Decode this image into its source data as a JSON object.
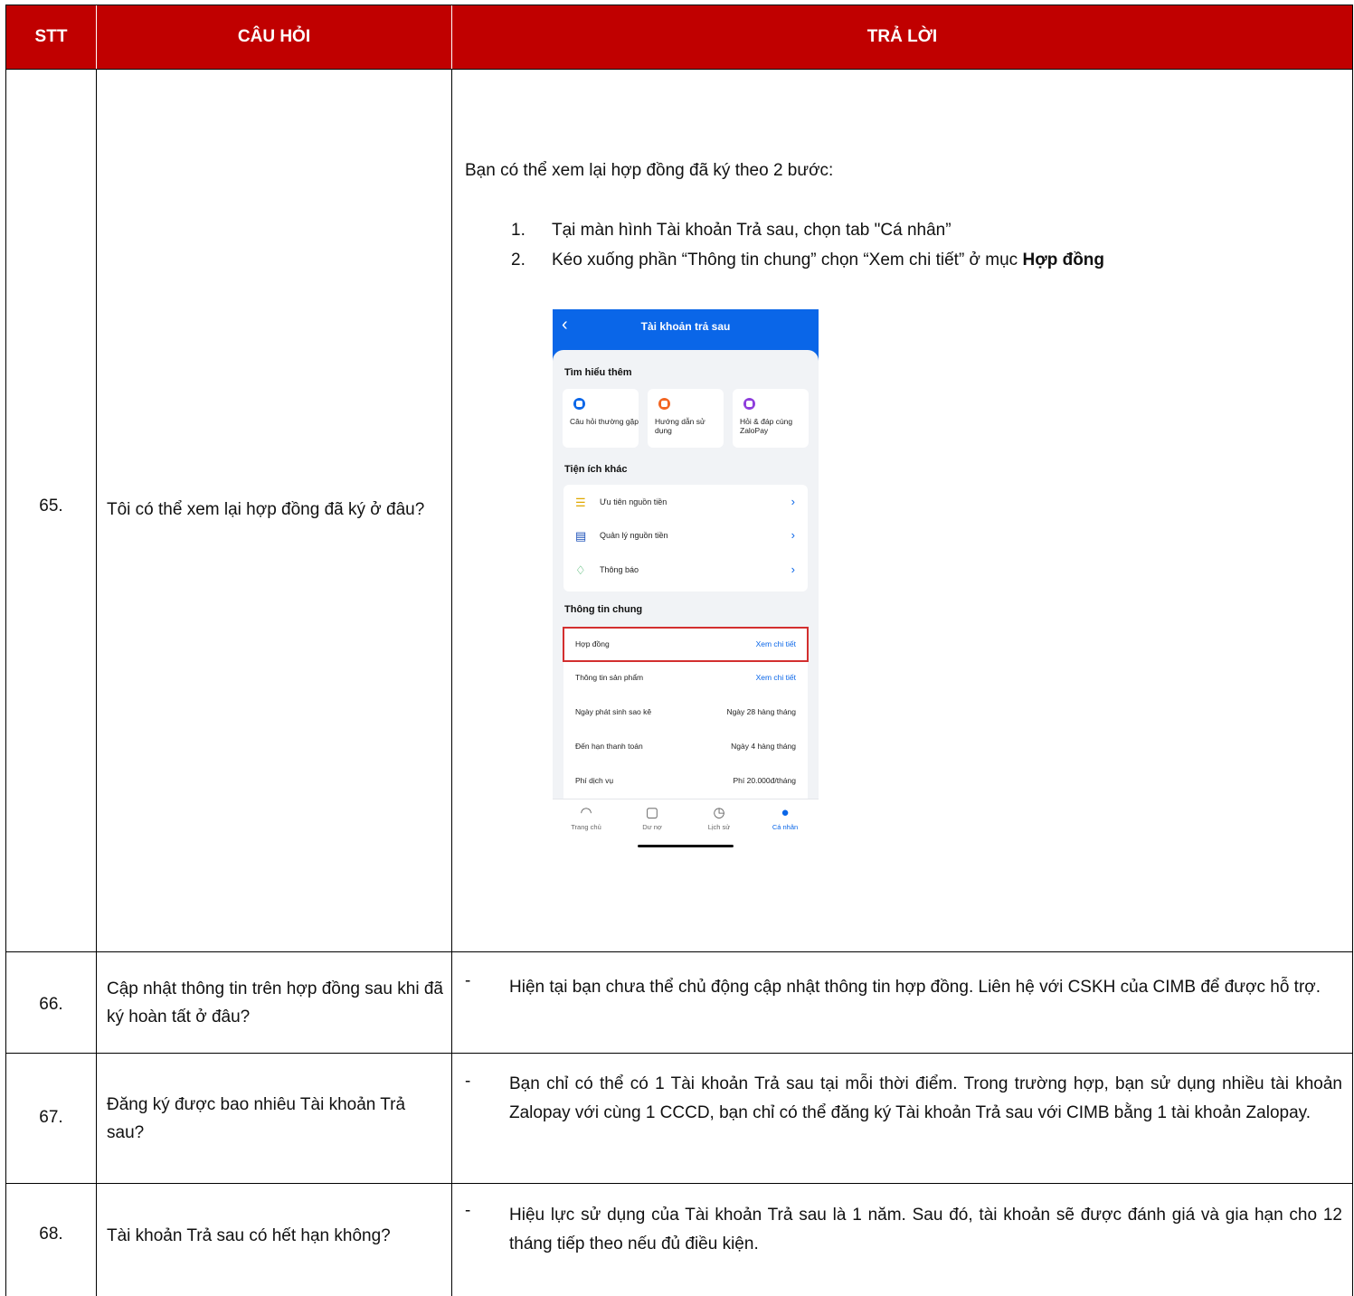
{
  "header": {
    "col_stt": "STT",
    "col_question": "CÂU HỎI",
    "col_answer": "TRẢ LỜI"
  },
  "rows": [
    {
      "num": "65.",
      "question": "Tôi có thể xem lại hợp đồng đã ký ở đâu?",
      "intro": "Bạn có thể xem lại hợp đồng đã ký theo 2 bước:",
      "steps": [
        {
          "n": "1.",
          "text": "Tại màn hình Tài khoản Trả sau, chọn tab \"Cá nhân”"
        },
        {
          "n": "2.",
          "text": "Kéo xuống phần “Thông tin chung” chọn “Xem chi tiết” ở mục ",
          "bold": "Hợp đồng"
        }
      ]
    },
    {
      "num": "66.",
      "question": "Cập nhật thông tin trên hợp đồng sau khi đã ký hoàn tất ở đâu?",
      "dash": "-",
      "answer": "Hiện tại bạn chưa thể chủ động cập nhật thông tin hợp đồng. Liên hệ với CSKH của CIMB để được hỗ trợ."
    },
    {
      "num": "67.",
      "question": "Đăng ký được bao nhiêu Tài khoản Trả sau?",
      "dash": "-",
      "answer": "Bạn chỉ có thể có 1 Tài khoản Trả sau tại mỗi thời điểm. Trong trường hợp, bạn sử dụng nhiều tài khoản Zalopay với cùng 1 CCCD, bạn chỉ có thể đăng ký Tài khoản Trả sau với CIMB bằng 1 tài khoản Zalopay."
    },
    {
      "num": "68.",
      "question": "Tài khoản Trả sau có hết hạn không?",
      "dash": "-",
      "answer": "Hiệu lực sử dụng của Tài khoản Trả sau là 1 năm. Sau đó, tài khoản sẽ được đánh giá và gia hạn cho 12 tháng tiếp theo nếu đủ điều kiện."
    }
  ],
  "phone": {
    "title": "Tài khoản trả sau",
    "section_learn": "Tìm hiểu thêm",
    "tiles": [
      {
        "label": "Câu hỏi thường gặp",
        "color": "#0a66e8"
      },
      {
        "label": "Hướng dẫn sử dụng",
        "color": "#f26522"
      },
      {
        "label": "Hỏi & đáp cùng ZaloPay",
        "color": "#8e3ddc"
      }
    ],
    "section_utils": "Tiện ích khác",
    "utils": [
      {
        "label": "Ưu tiên nguồn tiền",
        "icon": "☰",
        "color": "#e0a800"
      },
      {
        "label": "Quản lý nguồn tiền",
        "icon": "▤",
        "color": "#1a4fb8"
      },
      {
        "label": "Thông báo",
        "icon": "♢",
        "color": "#1fa34a"
      }
    ],
    "section_info": "Thông tin chung",
    "info": [
      {
        "label": "Hợp đồng",
        "value": "Xem chi tiết",
        "link": true,
        "highlight": true
      },
      {
        "label": "Thông tin sản phẩm",
        "value": "Xem chi tiết",
        "link": true
      },
      {
        "label": "Ngày phát sinh sao kê",
        "value": "Ngày 28 hàng tháng"
      },
      {
        "label": "Đến hạn thanh toán",
        "value": "Ngày 4 hàng tháng"
      },
      {
        "label": "Phí dịch vụ",
        "value": "Phí 20.000đ/tháng"
      }
    ],
    "nav": [
      {
        "label": "Trang chủ",
        "icon": "◠"
      },
      {
        "label": "Dư nợ",
        "icon": "▢"
      },
      {
        "label": "Lịch sử",
        "icon": "◷"
      },
      {
        "label": "Cá nhân",
        "icon": "●",
        "active": true
      }
    ],
    "colors": {
      "header_blue": "#0a66e8",
      "highlight_red": "#d32f2f"
    }
  },
  "colors": {
    "header_bg": "#c00000",
    "header_text": "#ffffff"
  }
}
